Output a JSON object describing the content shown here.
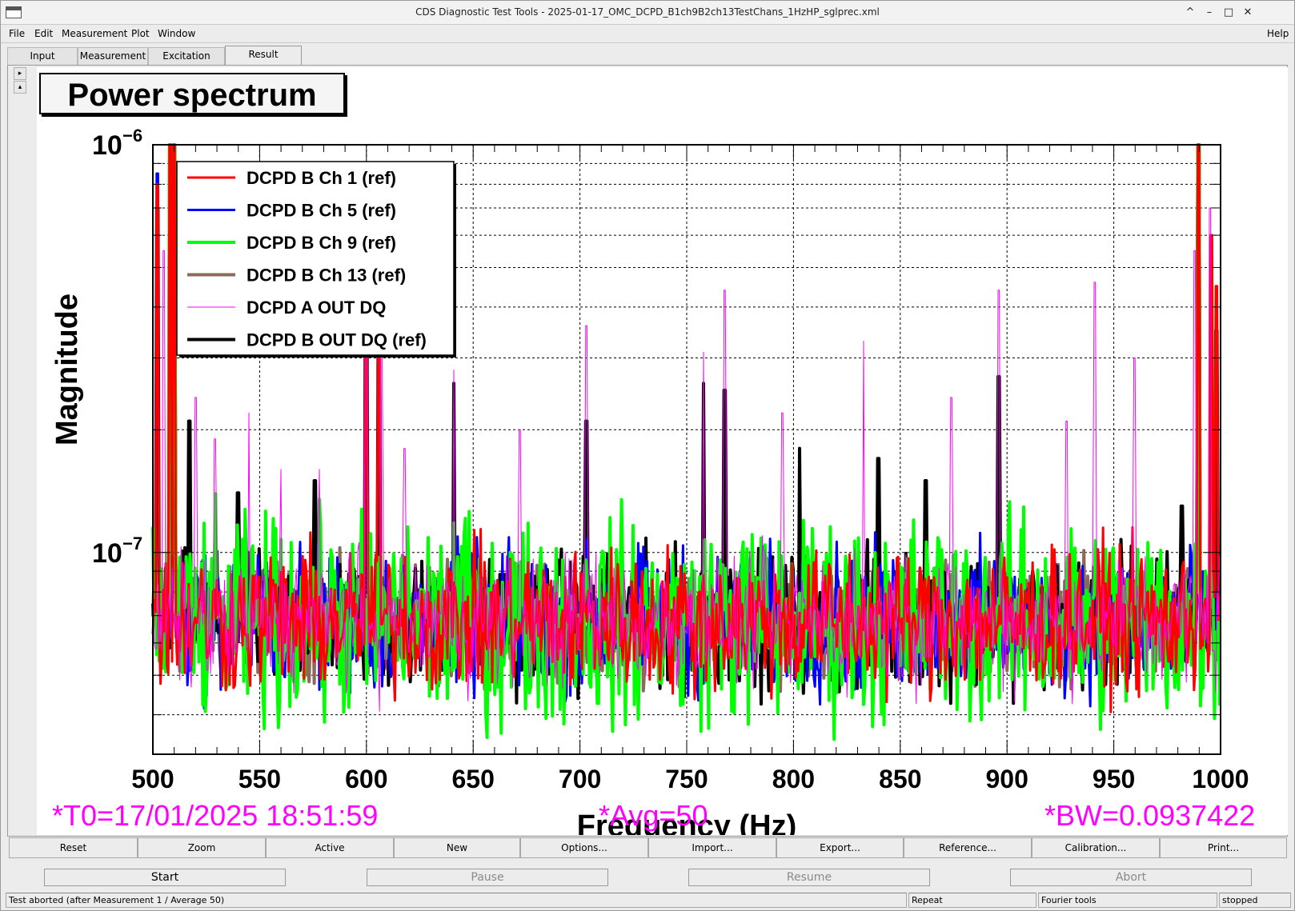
{
  "window": {
    "title": "CDS Diagnostic Test Tools - 2025-01-17_OMC_DCPD_B1ch9B2ch13TestChans_1HzHP_sglprec.xml",
    "controls": [
      "^",
      "–",
      "□",
      "✕"
    ]
  },
  "menubar": {
    "items": [
      "File",
      "Edit",
      "Measurement",
      "Plot",
      "Window"
    ],
    "help": "Help"
  },
  "tabs": [
    "Input",
    "Measurement",
    "Excitation",
    "Result"
  ],
  "active_tab": "Result",
  "plot": {
    "title": "Power spectrum",
    "info_t0": "*T0=17/01/2025 18:51:59",
    "info_avg": "*Avg=50",
    "info_bw": "*BW=0.0937422"
  },
  "toolbar": [
    "Reset",
    "Zoom",
    "Active",
    "New",
    "Options...",
    "Import...",
    "Export...",
    "Reference...",
    "Calibration...",
    "Print..."
  ],
  "actions": [
    {
      "label": "Start",
      "enabled": true
    },
    {
      "label": "Pause",
      "enabled": false
    },
    {
      "label": "Resume",
      "enabled": false
    },
    {
      "label": "Abort",
      "enabled": false
    }
  ],
  "status": {
    "message": "Test aborted (after Measurement 1 / Average 50)",
    "mode": "Repeat",
    "tool": "Fourier tools",
    "state": "stopped"
  },
  "chart_data": {
    "type": "line",
    "title": "Power spectrum",
    "xlabel": "Frequency (Hz)",
    "ylabel": "Magnitude",
    "x_scale": "linear",
    "y_scale": "log",
    "xlim": [
      500,
      1000
    ],
    "ylim": [
      3.2e-08,
      1e-06
    ],
    "x_ticks": [
      500,
      550,
      600,
      650,
      700,
      750,
      800,
      850,
      900,
      950,
      1000
    ],
    "x_tick_labels": [
      "500",
      "550",
      "600",
      "650",
      "700",
      "750",
      "800",
      "850",
      "900",
      "950",
      "1000"
    ],
    "y_tick_labels": [
      {
        "value": 1e-06,
        "mantissa": "10",
        "exp": "−6"
      },
      {
        "value": 1e-07,
        "mantissa": "10",
        "exp": "−7"
      }
    ],
    "grid": true,
    "legend_position": "top-left",
    "noise_floor": 6.8e-08,
    "series": [
      {
        "name": "DCPD B Ch 1 (ref)",
        "color": "#ff0000",
        "width": 3,
        "peaks": [
          [
            502,
            8e-07
          ],
          [
            508,
            1e-06
          ],
          [
            510,
            1e-06
          ],
          [
            600,
            4e-07
          ],
          [
            606,
            3e-07
          ],
          [
            990,
            1e-06
          ],
          [
            996,
            6e-07
          ],
          [
            998,
            4.5e-07
          ]
        ]
      },
      {
        "name": "DCPD B Ch 5 (ref)",
        "color": "#0000ff",
        "width": 3,
        "peaks": [
          [
            502,
            8.5e-07
          ],
          [
            508,
            1e-06
          ],
          [
            510,
            1e-06
          ],
          [
            600,
            4e-07
          ],
          [
            606,
            3e-07
          ],
          [
            990,
            1e-06
          ],
          [
            996,
            6e-07
          ]
        ]
      },
      {
        "name": "DCPD B Ch 9 (ref)",
        "color": "#00ff00",
        "width": 4,
        "peaks": [
          [
            508,
            1e-06
          ],
          [
            510,
            1e-06
          ],
          [
            990,
            1e-06
          ],
          [
            996,
            5e-07
          ]
        ]
      },
      {
        "name": "DCPD B Ch 13 (ref)",
        "color": "#8b6a5a",
        "width": 4,
        "peaks": [
          [
            508,
            1e-06
          ],
          [
            510,
            1e-06
          ],
          [
            990,
            1e-06
          ]
        ]
      },
      {
        "name": "DCPD A OUT DQ",
        "color": "#ff00ff",
        "width": 1,
        "peaks": [
          [
            505,
            5.5e-07
          ],
          [
            520,
            2.4e-07
          ],
          [
            529,
            1.9e-07
          ],
          [
            545,
            2.2e-07
          ],
          [
            560,
            1.6e-07
          ],
          [
            578,
            1.6e-07
          ],
          [
            600,
            5.2e-07
          ],
          [
            607,
            3.5e-07
          ],
          [
            618,
            1.8e-07
          ],
          [
            641,
            2.8e-07
          ],
          [
            672,
            2e-07
          ],
          [
            703,
            3.6e-07
          ],
          [
            758,
            3.1e-07
          ],
          [
            768,
            4.4e-07
          ],
          [
            795,
            2.2e-07
          ],
          [
            833,
            3.3e-07
          ],
          [
            874,
            2.4e-07
          ],
          [
            896,
            4.4e-07
          ],
          [
            928,
            2.1e-07
          ],
          [
            941,
            4.6e-07
          ],
          [
            960,
            3e-07
          ],
          [
            988,
            5.5e-07
          ],
          [
            995,
            7e-07
          ]
        ]
      },
      {
        "name": "DCPD B OUT DQ (ref)",
        "color": "#000000",
        "width": 4,
        "peaks": [
          [
            502,
            7e-07
          ],
          [
            510,
            1e-06
          ],
          [
            517,
            2.1e-07
          ],
          [
            540,
            1.4e-07
          ],
          [
            576,
            1.5e-07
          ],
          [
            600,
            5.2e-07
          ],
          [
            606,
            3.5e-07
          ],
          [
            641,
            2.6e-07
          ],
          [
            703,
            2.1e-07
          ],
          [
            758,
            2.6e-07
          ],
          [
            768,
            2.5e-07
          ],
          [
            803,
            1.8e-07
          ],
          [
            840,
            1.7e-07
          ],
          [
            862,
            1.5e-07
          ],
          [
            896,
            2.7e-07
          ],
          [
            982,
            1.3e-07
          ],
          [
            990,
            1e-06
          ],
          [
            998,
            3.5e-07
          ]
        ]
      }
    ]
  }
}
